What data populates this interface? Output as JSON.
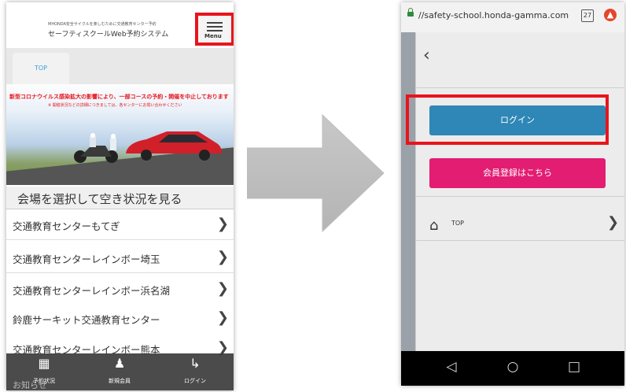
{
  "left_screen": {
    "header_line1": "MHONDA安全サイクルを楽しむために交通教育センター予約",
    "header_line2": "セーフティスクールWeb予約システム",
    "menu_label": "Menu",
    "tab_top": "TOP",
    "banner_line1": "新型コロナウイルス感染拡大の影響により、一部コースの予約・開催を中止しております",
    "banner_line2": "※ 開催状況などの詳細につきましては、各センターにお問い合わせください",
    "venue_heading": "会場を選択して空き状況を見る",
    "venues": [
      "交通教育センターもてぎ",
      "交通教育センターレインボー埼玉",
      "交通教育センターレインボー浜名湖",
      "鈴鹿サーキット交通教育センター",
      "交通教育センターレインボー熊本"
    ],
    "behind_text": "お知らせ",
    "bottom_nav": [
      {
        "label": "予約状況",
        "icon": "calendar-edit-icon"
      },
      {
        "label": "新規会員",
        "icon": "add-user-icon"
      },
      {
        "label": "ログイン",
        "icon": "login-icon"
      }
    ]
  },
  "right_screen": {
    "url": "//safety-school.honda-gamma.com",
    "tab_count": "27",
    "login_button": "ログイン",
    "register_button": "会員登録はこちら",
    "top_link": "TOP"
  },
  "colors": {
    "highlight": "#e8141c",
    "login_button": "#2e87b6",
    "register_button": "#e21d72",
    "tab_text": "#3aa0d8"
  }
}
